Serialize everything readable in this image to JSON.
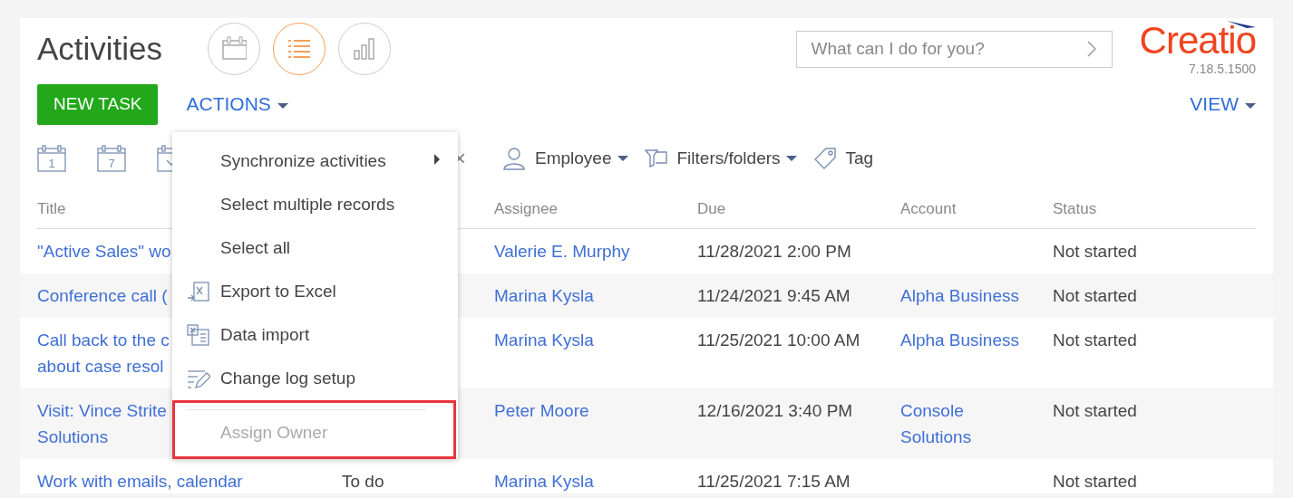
{
  "header": {
    "title": "Activities",
    "views": [
      {
        "kind": "calendar",
        "selected": false
      },
      {
        "kind": "list",
        "selected": true
      },
      {
        "kind": "chart",
        "selected": false
      }
    ],
    "search": {
      "placeholder": "What can I do for you?"
    },
    "logo": {
      "text": "Creatio",
      "version": "7.18.5.1500"
    }
  },
  "actions": {
    "primary": "NEW TASK",
    "menu": "ACTIONS",
    "view": "VIEW"
  },
  "filters": {
    "periods": [
      {
        "kind": "day",
        "label": "1"
      },
      {
        "kind": "week",
        "label": "7"
      },
      {
        "kind": "custom"
      }
    ],
    "clear": "×",
    "employee": "Employee",
    "folders": "Filters/folders",
    "tag": "Tag"
  },
  "table": {
    "columns": [
      {
        "label": "Title"
      },
      {
        "label": "Assignee"
      },
      {
        "label": "Due"
      },
      {
        "label": "Account"
      },
      {
        "label": "Status"
      }
    ],
    "rows": [
      {
        "title": [
          "\"Active Sales\" wo"
        ],
        "assignee": "Valerie E. Murphy",
        "due": "11/28/2021 2:00 PM",
        "status": "Not started"
      },
      {
        "title": [
          "Conference call ("
        ],
        "assignee": "Marina Kysla",
        "due": "11/24/2021 9:45 AM",
        "account": [
          "Alpha Business"
        ],
        "status": "Not started"
      },
      {
        "title": [
          "Call back to the c",
          "about case resol"
        ],
        "assignee": "Marina Kysla",
        "due": "11/25/2021 10:00 AM",
        "account": [
          "Alpha Business"
        ],
        "status": "Not started"
      },
      {
        "title": [
          "Visit: Vince Strite",
          "Solutions"
        ],
        "assignee": "Peter Moore",
        "due": "12/16/2021 3:40 PM",
        "account": [
          "Console",
          "Solutions"
        ],
        "status": "Not started"
      },
      {
        "title": [
          "Work with emails, calendar"
        ],
        "type": "To do",
        "assignee": "Marina Kysla",
        "due": "11/25/2021 7:15 AM",
        "status": "Not started"
      }
    ]
  },
  "menu": {
    "items": [
      {
        "kind": "submenu",
        "label": "Synchronize activities",
        "disabled": false,
        "separator_before": false,
        "highlighted": false
      },
      {
        "kind": "plain",
        "label": "Select multiple records",
        "disabled": false,
        "separator_before": false,
        "highlighted": false
      },
      {
        "kind": "plain",
        "label": "Select all",
        "disabled": false,
        "separator_before": false,
        "highlighted": false
      },
      {
        "kind": "export",
        "label": "Export to Excel",
        "disabled": false,
        "separator_before": false,
        "highlighted": false
      },
      {
        "kind": "import",
        "label": "Data import",
        "disabled": false,
        "separator_before": false,
        "highlighted": false
      },
      {
        "kind": "log",
        "label": "Change log setup",
        "disabled": false,
        "separator_before": false,
        "highlighted": false
      },
      {
        "kind": "plain",
        "label": "Assign Owner",
        "disabled": true,
        "separator_before": true,
        "highlighted": true
      }
    ]
  }
}
